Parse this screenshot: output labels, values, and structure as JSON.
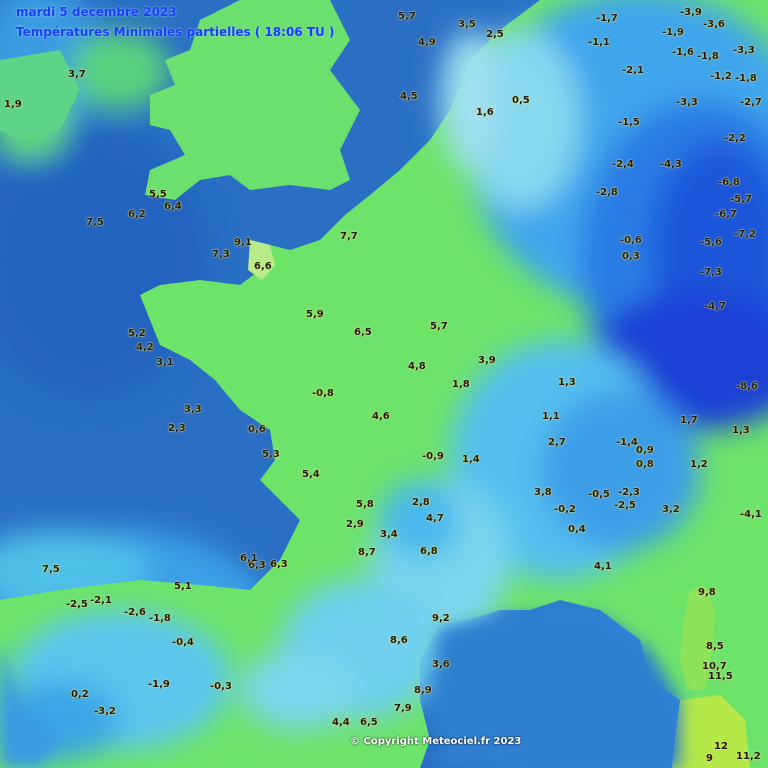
{
  "header": {
    "date": "mardi 5 décembre 2023",
    "subtitle": "Températures Minimales partielles ( 18:06 TU )"
  },
  "footer": {
    "copyright": "© Copyright Meteociel.fr 2023"
  },
  "colors": {
    "sea_deep": "#1f5fb8",
    "sea": "#2f7fd0",
    "cold_light": "#7fd0f0",
    "cool": "#4fb4ee",
    "mild": "#68e070",
    "warm": "#a9e84f",
    "very_cold": "#1538d8",
    "value_text": "#1a1a1a"
  },
  "values": [
    "5,7",
    "3,5",
    "2,5",
    "1,6",
    "0,5",
    "1,9",
    "-3,9",
    "-3,6",
    "-3,3",
    "-1,7",
    "-1,1",
    "-1,6",
    "-1,8",
    "-1,2",
    "-1,9",
    "-2,1",
    "-1,5",
    "-1,8",
    "-2,7",
    "-2,2",
    "-3,3",
    "-4,3",
    "-5,6",
    "-6,8",
    "-7,3",
    "-5,7",
    "-6,7",
    "-7,2",
    "-8,6",
    "-4,7",
    "-2,8",
    "-2,4",
    "-0,6",
    "0,3",
    "1,2",
    "1,7",
    "1,3",
    "0,9",
    "0,8",
    "3,2",
    "-4,1",
    "9,8",
    "8,5",
    "10,7",
    "11,5",
    "12",
    "9",
    "11,2",
    "4,5",
    "4,9",
    "3,7",
    "5,5",
    "6,4",
    "7,5",
    "6,2",
    "7,3",
    "9,1",
    "7,7",
    "6,6",
    "5,9",
    "6,5",
    "5,7",
    "4,8",
    "4,6",
    "3,9",
    "2,8",
    "1,8",
    "-0,5",
    "-2,3",
    "-2,5",
    "-1,4",
    "-0,2",
    "0,4",
    "2,9",
    "3,4",
    "4,7",
    "6,8",
    "8,7",
    "8,6",
    "9,2",
    "8,9",
    "7,9",
    "6,5",
    "4,4",
    "3,6",
    "-1,9",
    "-3,2",
    "-0,3",
    "0,2",
    "-0,4",
    "-2,6",
    "-1,8",
    "-2,1",
    "-2,5",
    "6,3",
    "7,5",
    "5,1",
    "5,2",
    "4,2",
    "3,1",
    "3,3",
    "2,3",
    "0,6",
    "-0,8",
    "-0,9",
    "1,4",
    "1,3",
    "1,1",
    "2,7",
    "3,8",
    "4,1",
    "5,3",
    "5,4",
    "5,8",
    "6,1",
    "6,3"
  ],
  "scale_note": ""
}
